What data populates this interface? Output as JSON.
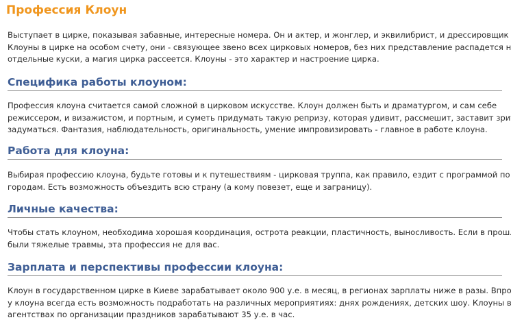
{
  "article": {
    "title": "Профессия Клоун",
    "intro": [
      "Выступает в цирке, показывая забавные, интересные номера. Он и актер, и жонглер, и эквилибрист, и дрессировщик",
      "Клоуны в цирке на особом счету, они - связующее звено всех цирковых номеров, без них представление распадется на",
      "отдельные куски, а магия цирка рассеется. Клоуны - это характер и настроение цирка."
    ],
    "sections": [
      {
        "heading": "Специфика работы клоуном:",
        "lines": [
          "Профессия клоуна считается самой сложной в цирковом искусстве. Клоун должен быть и драматургом, и сам себе",
          "режиссером, и визажистом, и портным, и суметь придумать такую репризу, которая удивит, рассмешит, заставит зрителей",
          "задуматься. Фантазия, наблюдательность, оригинальность, умение импровизировать - главное в работе клоуна."
        ]
      },
      {
        "heading": "Работа для клоуна:",
        "lines": [
          "Выбирая профессию клоуна, будьте готовы и к путешествиям - цирковая труппа, как правило, ездит с программой по",
          "городам. Есть возможность объездить всю страну (а кому повезет, еще и заграницу)."
        ]
      },
      {
        "heading": "Личные качества:",
        "lines": [
          "Чтобы стать клоуном, необходима хорошая координация, острота реакции, пластичность, выносливость. Если в прошлом",
          "были тяжелые травмы, эта профессия не для вас."
        ]
      },
      {
        "heading": "Зарплата и перспективы профессии клоуна:",
        "lines": [
          "Клоун в государственном цирке в Киеве зарабатывает около 900 у.е. в месяц, в регионах зарплаты ниже в разы. Впрочем,",
          "у клоуна всегда есть возможность подработать на различных мероприятиях: днях рождениях, детских шоу. Клоуны в",
          "агентствах по организации праздников зарабатывают 35 у.е. в час."
        ]
      }
    ]
  },
  "colors": {
    "title": "#f0961e",
    "heading": "#3f5e95",
    "text": "#2b2b2b",
    "rule": "#8a8a8a"
  }
}
